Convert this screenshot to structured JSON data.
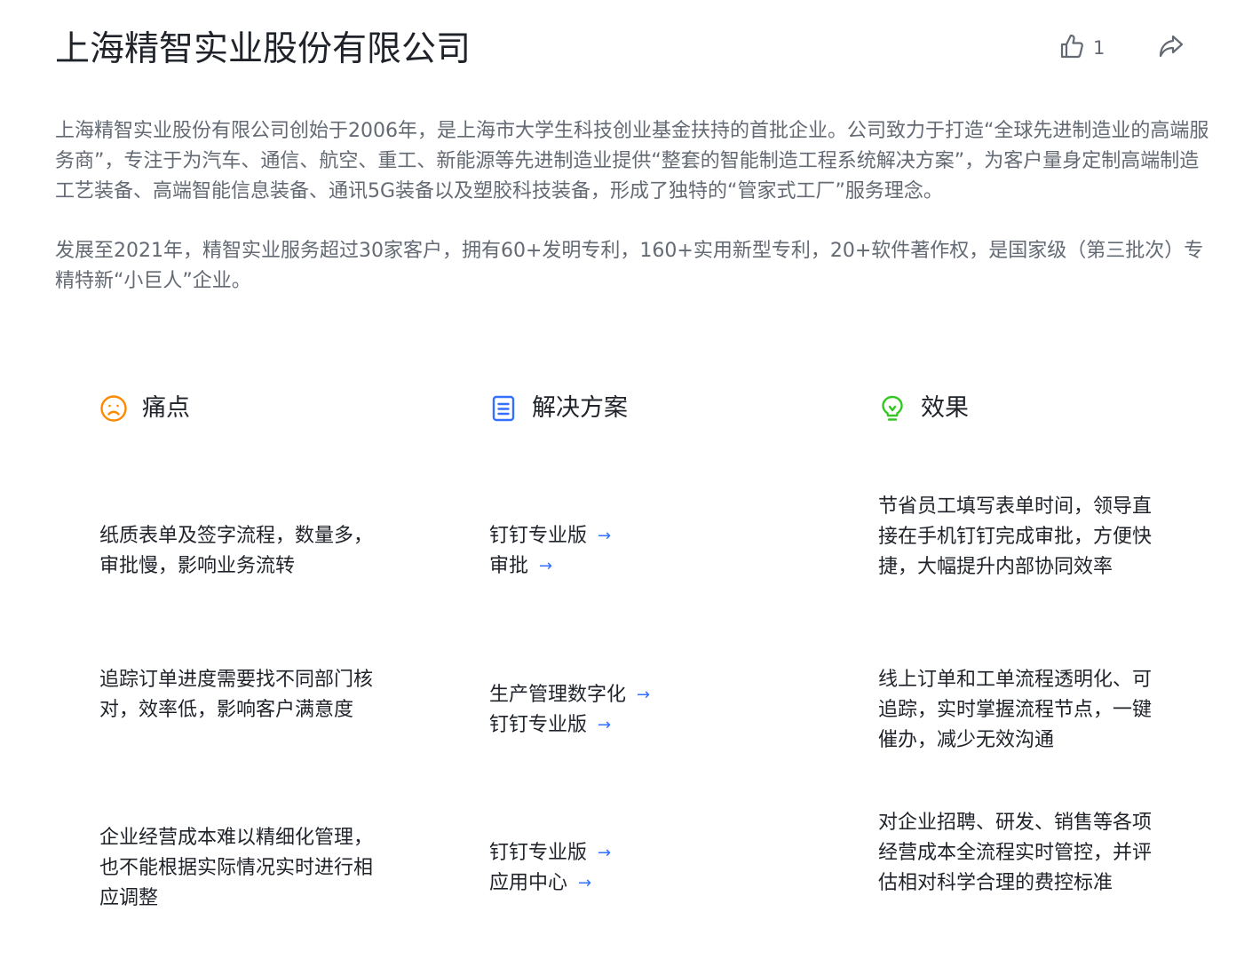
{
  "header": {
    "title": "上海精智实业股份有限公司",
    "like_count": "1",
    "like_icon": "thumbs-up-icon",
    "share_icon": "share-icon"
  },
  "intro": {
    "paragraphs": [
      "上海精智实业股份有限公司创始于2006年，是上海市大学生科技创业基金扶持的首批企业。公司致力于打造“全球先进制造业的高端服务商”，专注于为汽车、通信、航空、重工、新能源等先进制造业提供“整套的智能制造工程系统解决方案”，为客户量身定制高端制造工艺装备、高端智能信息装备、通讯5G装备以及塑胶科技装备，形成了独特的“管家式工厂”服务理念。",
      "发展至2021年，精智实业服务超过30家客户，拥有60+发明专利，160+实用新型专利，20+软件著作权，是国家级（第三批次）专精特新“小巨人”企业。"
    ]
  },
  "columns": {
    "pain": {
      "label": "痛点",
      "icon": "sad-face-icon",
      "color": "#ff8800"
    },
    "solution": {
      "label": "解决方案",
      "icon": "document-icon",
      "color": "#3370ff"
    },
    "effect": {
      "label": "效果",
      "icon": "lightbulb-icon",
      "color": "#34c724"
    }
  },
  "rows": [
    {
      "pain": "纸质表单及签字流程，数量多，审批慢，影响业务流转",
      "solutions": [
        "钉钉专业版",
        "审批"
      ],
      "effect": "节省员工填写表单时间，领导直接在手机钉钉完成审批，方便快捷，大幅提升内部协同效率"
    },
    {
      "pain": "追踪订单进度需要找不同部门核对，效率低，影响客户满意度",
      "solutions": [
        "生产管理数字化",
        "钉钉专业版"
      ],
      "effect": "线上订单和工单流程透明化、可追踪，实时掌握流程节点，一键催办，减少无效沟通"
    },
    {
      "pain": "企业经营成本难以精细化管理，也不能根据实际情况实时进行相应调整",
      "solutions": [
        "钉钉专业版",
        "应用中心"
      ],
      "effect": "对企业招聘、研发、销售等各项经营成本全流程实时管控，并评估相对科学合理的费控标准"
    }
  ],
  "colors": {
    "text_primary": "#1f2329",
    "text_secondary": "#646a73",
    "link_arrow": "#3370ff"
  }
}
